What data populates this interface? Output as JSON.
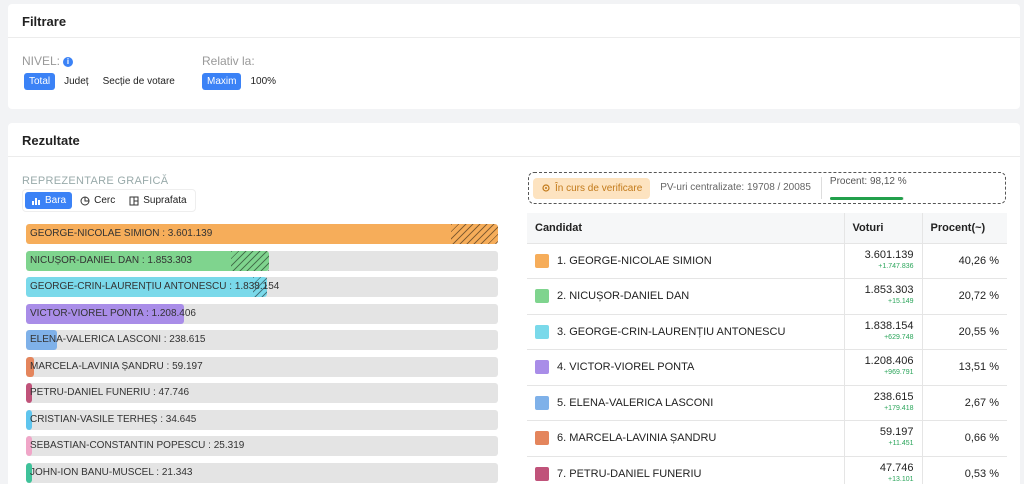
{
  "filters": {
    "title": "Filtrare",
    "level_label": "NIVEL:",
    "level_options": [
      "Total",
      "Județ",
      "Secție de votare"
    ],
    "relative_label": "Relativ la:",
    "relative_options": [
      "Maxim",
      "100%"
    ]
  },
  "results": {
    "title": "Rezultate",
    "rep_label": "REPREZENTARE GRAFICĂ",
    "rep_tabs": [
      "Bara",
      "Cerc",
      "Suprafata"
    ],
    "bars": [
      {
        "label": "GEORGE-NICOLAE SIMION : 3.601.139",
        "value": 3601139,
        "color": "#f6ad5a",
        "hatch": 0.1
      },
      {
        "label": "NICUȘOR-DANIEL DAN : 1.853.303",
        "value": 1853303,
        "color": "#7fd48e",
        "hatch": 0.08
      },
      {
        "label": "GEORGE-CRIN-LAURENȚIU ANTONESCU : 1.838.154",
        "value": 1838154,
        "color": "#7ad9ea",
        "hatch": 0.03
      },
      {
        "label": "VICTOR-VIOREL PONTA : 1.208.406",
        "value": 1208406,
        "color": "#a98de8",
        "hatch": 0
      },
      {
        "label": "ELENA-VALERICA LASCONI : 238.615",
        "value": 238615,
        "color": "#7fb1e9",
        "hatch": 0
      },
      {
        "label": "MARCELA-LAVINIA ȘANDRU : 59.197",
        "value": 59197,
        "color": "#e4855c",
        "hatch": 0
      },
      {
        "label": "PETRU-DANIEL FUNERIU : 47.746",
        "value": 47746,
        "color": "#c0537a",
        "hatch": 0
      },
      {
        "label": "CRISTIAN-VASILE TERHEȘ : 34.645",
        "value": 34645,
        "color": "#5fc5ee",
        "hatch": 0
      },
      {
        "label": "SEBASTIAN-CONSTANTIN POPESCU : 25.319",
        "value": 25319,
        "color": "#f0a6c8",
        "hatch": 0
      },
      {
        "label": "JOHN-ION BANU-MUSCEL : 21.343",
        "value": 21343,
        "color": "#3fc29a",
        "hatch": 0
      }
    ],
    "status": {
      "verif": "În curs de verificare",
      "pv": "PV-uri centralizate: 19708 / 20085",
      "percent_label": "Procent: 98,12 %",
      "percent": 0.9812
    },
    "table": {
      "headers": [
        "Candidat",
        "Voturi",
        "Procent(~)"
      ],
      "rows": [
        {
          "name": "1. GEORGE-NICOLAE SIMION",
          "votes": "3.601.139",
          "delta": "+1.747.836",
          "pct": "40,26 %",
          "color": "#f6ad5a"
        },
        {
          "name": "2. NICUȘOR-DANIEL DAN",
          "votes": "1.853.303",
          "delta": "+15.149",
          "pct": "20,72 %",
          "color": "#7fd48e"
        },
        {
          "name": "3. GEORGE-CRIN-LAURENȚIU ANTONESCU",
          "votes": "1.838.154",
          "delta": "+629.748",
          "pct": "20,55 %",
          "color": "#7ad9ea"
        },
        {
          "name": "4. VICTOR-VIOREL PONTA",
          "votes": "1.208.406",
          "delta": "+969.791",
          "pct": "13,51 %",
          "color": "#a98de8"
        },
        {
          "name": "5. ELENA-VALERICA LASCONI",
          "votes": "238.615",
          "delta": "+179.418",
          "pct": "2,67 %",
          "color": "#7fb1e9"
        },
        {
          "name": "6. MARCELA-LAVINIA ȘANDRU",
          "votes": "59.197",
          "delta": "+11.451",
          "pct": "0,66 %",
          "color": "#e4855c"
        },
        {
          "name": "7. PETRU-DANIEL FUNERIU",
          "votes": "47.746",
          "delta": "+13.101",
          "pct": "0,53 %",
          "color": "#c0537a"
        }
      ]
    }
  }
}
